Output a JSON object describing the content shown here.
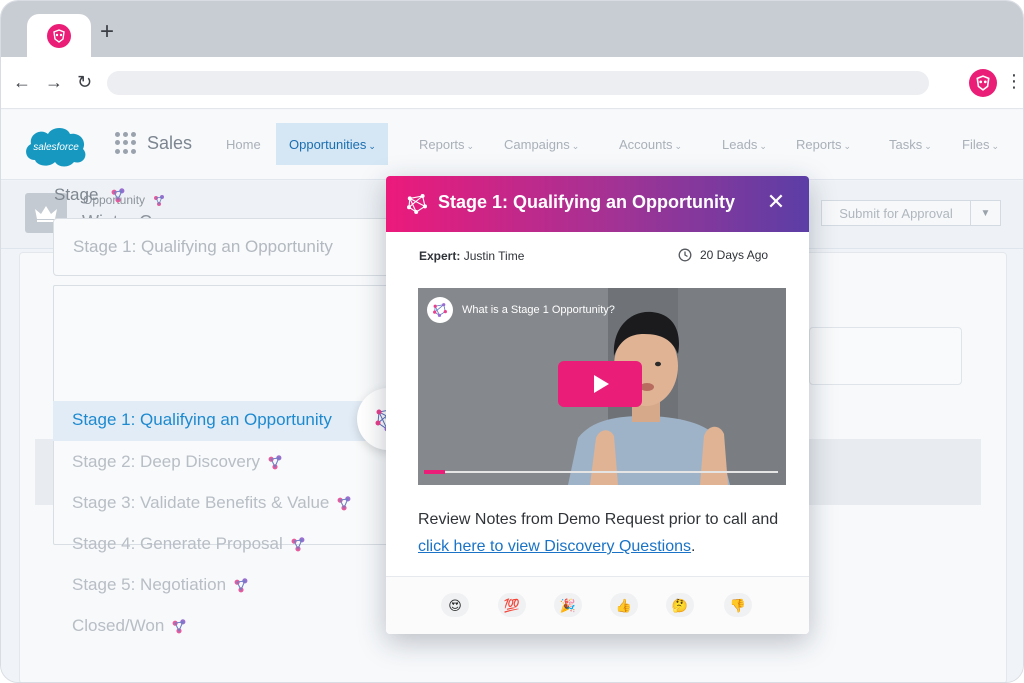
{
  "browser": {
    "new_tab_symbol": "+",
    "back_symbol": "←",
    "forward_symbol": "→",
    "reload_symbol": "↻",
    "menu_symbol": "⋮",
    "tab_icon": "walkme-owl-icon",
    "accent_color": "#ea1e77"
  },
  "header": {
    "logo_text": "salesforce",
    "app_name": "Sales",
    "nav": [
      {
        "label": "Home"
      },
      {
        "label": "Opportunities",
        "chevron": "⌄"
      },
      {
        "label": "Reports",
        "chevron": "⌄"
      },
      {
        "label": "Campaigns",
        "chevron": "⌄"
      },
      {
        "label": "Accounts",
        "chevron": "⌄"
      },
      {
        "label": "Leads",
        "chevron": "⌄"
      },
      {
        "label": "Reports",
        "chevron": "⌄"
      },
      {
        "label": "Tasks",
        "chevron": "⌄"
      },
      {
        "label": "Files",
        "chevron": "⌄"
      }
    ]
  },
  "record": {
    "type_label": "Opportunity",
    "name": "Winter Corp",
    "submit_label": "Submit for Approval",
    "dropdown_symbol": "▼"
  },
  "stage": {
    "label": "Stage",
    "selected_value": "Stage 1: Qualifying an Opportunity",
    "options": [
      "Stage 1: Qualifying an Opportunity",
      "Stage 2: Deep Discovery",
      "Stage 3: Validate Benefits & Value",
      "Stage 4: Generate Proposal",
      "Stage 5: Negotiation",
      "Closed/Won"
    ]
  },
  "popup": {
    "title": "Stage 1: Qualifying an Opportunity",
    "close_symbol": "✕",
    "expert_label": "Expert:",
    "expert_name": "Justin Time",
    "time_ago": "20 Days Ago",
    "video_title": "What is a Stage 1 Opportunity?",
    "video_progress": 0.06,
    "body_text": "Review Notes from Demo Request prior to call and",
    "link_text": "click here to view Discovery Questions",
    "body_end": ".",
    "header_colors": [
      "#ec1a7b",
      "#5b3ea6"
    ],
    "reactions": [
      "😍",
      "💯",
      "🎉",
      "👍",
      "🤔",
      "👎"
    ]
  }
}
